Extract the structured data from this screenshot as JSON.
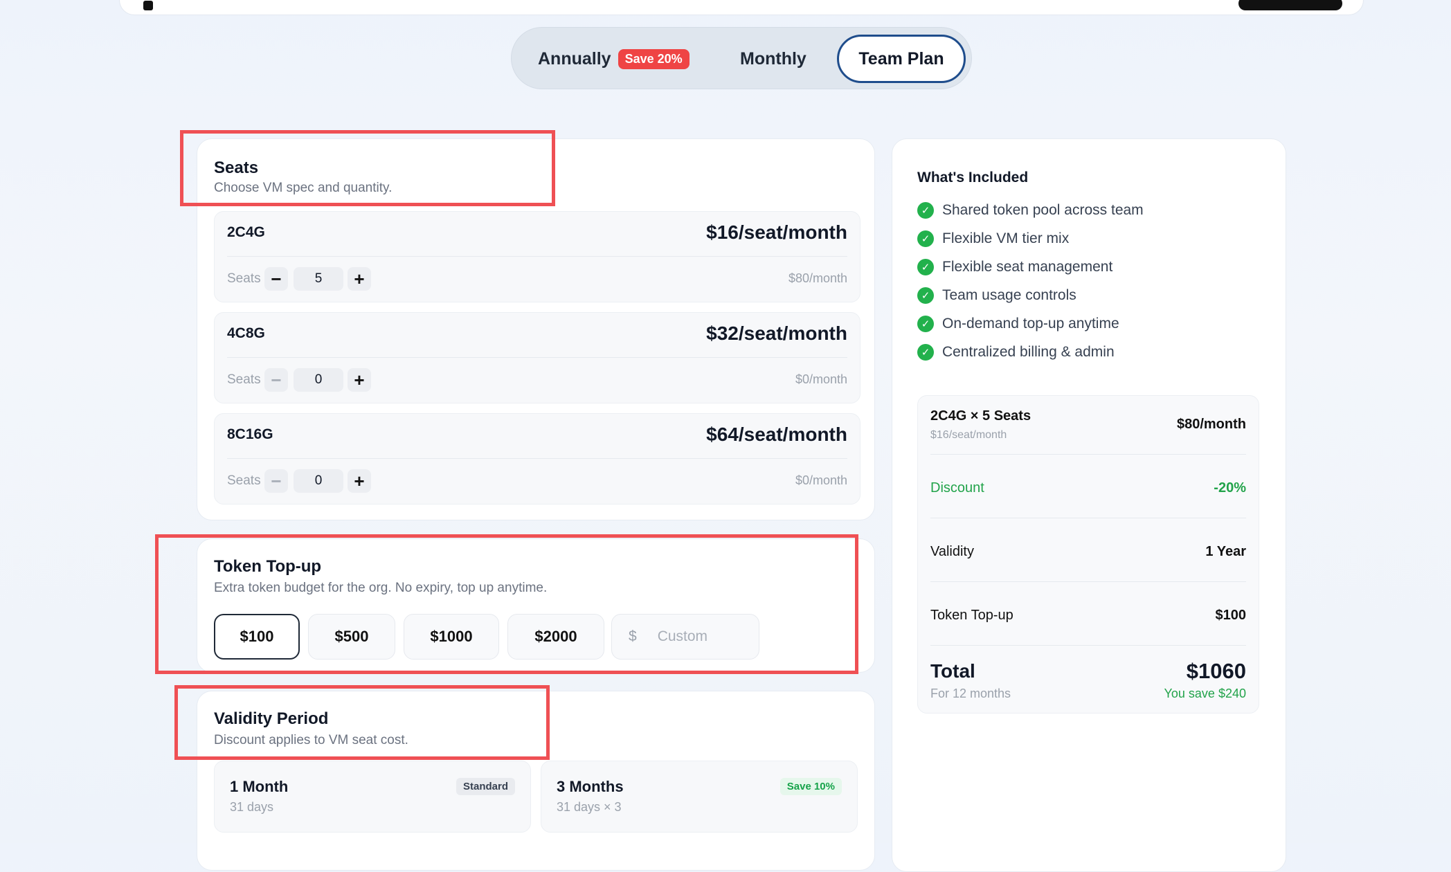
{
  "billing_toggle": {
    "annually": "Annually",
    "annually_badge": "Save 20%",
    "monthly": "Monthly",
    "team_plan": "Team Plan"
  },
  "seats": {
    "title": "Seats",
    "subtitle": "Choose VM spec and quantity.",
    "seats_label": "Seats",
    "tiers": [
      {
        "name": "2C4G",
        "price": "$16/seat/month",
        "count": "5",
        "total": "$80/month"
      },
      {
        "name": "4C8G",
        "price": "$32/seat/month",
        "count": "0",
        "total": "$0/month"
      },
      {
        "name": "8C16G",
        "price": "$64/seat/month",
        "count": "0",
        "total": "$0/month"
      }
    ]
  },
  "token_topup": {
    "title": "Token Top-up",
    "subtitle": "Extra token budget for the org. No expiry, top up anytime.",
    "amounts": [
      "$100",
      "$500",
      "$1000",
      "$2000"
    ],
    "selected": "$100",
    "custom_currency": "$",
    "custom_placeholder": "Custom"
  },
  "validity": {
    "title": "Validity Period",
    "subtitle": "Discount applies to VM seat cost.",
    "options": [
      {
        "name": "1 Month",
        "days": "31 days",
        "tag": "Standard"
      },
      {
        "name": "3 Months",
        "days": "31 days × 3",
        "tag": "Save 10%"
      }
    ]
  },
  "included": {
    "title": "What's Included",
    "features": [
      "Shared token pool across team",
      "Flexible VM tier mix",
      "Flexible seat management",
      "Team usage controls",
      "On-demand top-up anytime",
      "Centralized billing & admin"
    ]
  },
  "summary": {
    "line_item": "2C4G × 5 Seats",
    "line_item_sub": "$16/seat/month",
    "line_item_value": "$80/month",
    "discount_label": "Discount",
    "discount_value": "-20%",
    "validity_label": "Validity",
    "validity_value": "1 Year",
    "topup_label": "Token Top-up",
    "topup_value": "$100",
    "total_label": "Total",
    "total_value": "$1060",
    "total_sub": "For 12 months",
    "savings": "You save $240"
  },
  "colors": {
    "accent": "#1f4d8c",
    "badge_red": "#ef4444",
    "success_green": "#22a34a",
    "annotation_red": "#ef5054"
  },
  "icons": {
    "feature_check": "check-circle-icon"
  }
}
